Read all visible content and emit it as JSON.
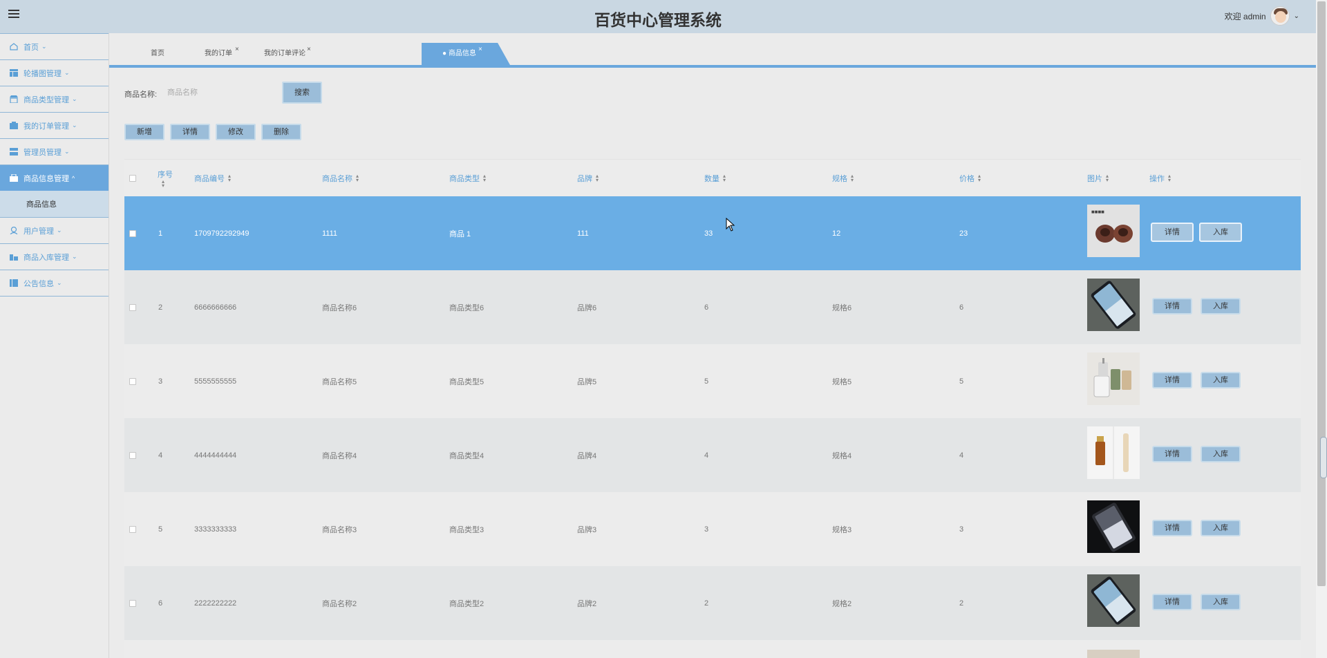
{
  "header": {
    "title": "百货中心管理系统",
    "welcome": "欢迎 admin"
  },
  "sidebar": {
    "items": [
      {
        "label": "首页",
        "icon": "home-icon"
      },
      {
        "label": "轮播图管理",
        "icon": "carousel-icon"
      },
      {
        "label": "商品类型管理",
        "icon": "shop-icon"
      },
      {
        "label": "我的订单管理",
        "icon": "order-icon"
      },
      {
        "label": "管理员管理",
        "icon": "admin-icon"
      },
      {
        "label": "商品信息管理",
        "icon": "goods-icon",
        "active": true
      },
      {
        "label": "用户管理",
        "icon": "user-icon"
      },
      {
        "label": "商品入库管理",
        "icon": "stock-icon"
      },
      {
        "label": "公告信息",
        "icon": "notice-icon"
      }
    ],
    "sub_item": "商品信息"
  },
  "tabs": [
    {
      "label": "首页"
    },
    {
      "label": "我的订单",
      "close": "×"
    },
    {
      "label": "我的订单评论",
      "close": "×"
    },
    {
      "label": "● 商品信息",
      "close": "×",
      "active": true
    }
  ],
  "search": {
    "label": "商品名称:",
    "placeholder": "商品名称",
    "button": "搜索"
  },
  "actions": {
    "add": "新增",
    "detail": "详情",
    "edit": "修改",
    "delete": "删除"
  },
  "table": {
    "columns": [
      "序号",
      "商品编号",
      "商品名称",
      "商品类型",
      "品牌",
      "数量",
      "规格",
      "价格",
      "图片",
      "操作"
    ],
    "rows": [
      {
        "idx": "1",
        "code": "1709792292949",
        "name": "1111",
        "type": "商品 1",
        "brand": "111",
        "qty": "33",
        "spec": "12",
        "price": "23",
        "pic": "brown-cups"
      },
      {
        "idx": "2",
        "code": "6666666666",
        "name": "商品名称6",
        "type": "商品类型6",
        "brand": "品牌6",
        "qty": "6",
        "spec": "规格6",
        "price": "6",
        "pic": "phone-blue"
      },
      {
        "idx": "3",
        "code": "5555555555",
        "name": "商品名称5",
        "type": "商品类型5",
        "brand": "品牌5",
        "qty": "5",
        "spec": "规格5",
        "price": "5",
        "pic": "cups-set"
      },
      {
        "idx": "4",
        "code": "4444444444",
        "name": "商品名称4",
        "type": "商品类型4",
        "brand": "品牌4",
        "qty": "4",
        "spec": "规格4",
        "price": "4",
        "pic": "cosmetics"
      },
      {
        "idx": "5",
        "code": "3333333333",
        "name": "商品名称3",
        "type": "商品类型3",
        "brand": "品牌3",
        "qty": "3",
        "spec": "规格3",
        "price": "3",
        "pic": "phone-dark"
      },
      {
        "idx": "6",
        "code": "2222222222",
        "name": "商品名称2",
        "type": "商品类型2",
        "brand": "品牌2",
        "qty": "2",
        "spec": "规格2",
        "price": "2",
        "pic": "phone-blue"
      }
    ],
    "row_detail": "详情",
    "row_stock": "入库"
  },
  "colors": {
    "accent": "#6aa7dd",
    "header_bg": "#c9d7e2",
    "selected_row": "#6aaee5"
  }
}
